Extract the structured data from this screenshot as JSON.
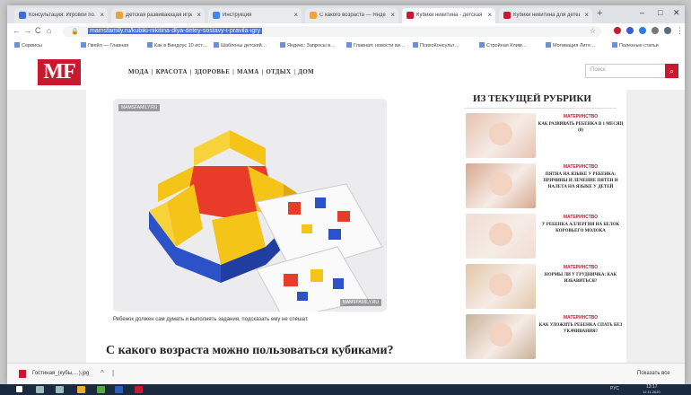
{
  "browser": {
    "tabs": [
      {
        "title": "Консультация: Игровой по…",
        "color": "#3c6fd1",
        "active": false
      },
      {
        "title": "Детская развивающая игра…",
        "color": "#e8a33b",
        "active": false
      },
      {
        "title": "Инструкция",
        "color": "#4285f4",
        "active": false
      },
      {
        "title": "С какого возраста — Яндекс",
        "color": "#f2a33a",
        "active": false
      },
      {
        "title": "Кубики никитина - детская…",
        "color": "#c8192f",
        "active": true
      },
      {
        "title": "Кубики никитина для детей…",
        "color": "#c8192f",
        "active": false
      }
    ],
    "new_tab": "+",
    "address": {
      "url": "mamsfamily.ru/kubiki-nikitina-dlya-detey-sostavy-i-pravila-igry",
      "back": "←",
      "forward": "→",
      "reload": "C",
      "home": "⌂"
    },
    "bookmarks": [
      "Сервисы",
      "Гмейл — Главная",
      "Как в Виндоус 10 ист…",
      "Шаблоны детский…",
      "Яндекс: Запросы в…",
      "Главная: новости ви…",
      "ПсихоКонсульт…",
      "Стройная Клим…",
      "Мотивация Лите…",
      "Полезные статьи"
    ]
  },
  "site": {
    "logo": "MF",
    "nav": [
      "МОДА",
      "КРАСОТА",
      "ЗДОРОВЬЕ",
      "МАМА",
      "ОТДЫХ",
      "ДОМ"
    ],
    "nav_separator": "|",
    "search_placeholder": "Поиск",
    "search_icon": "search-icon"
  },
  "article": {
    "watermark_top": "MAMSFAMILY.RU",
    "watermark_bottom": "MAMSFAMILY.RU",
    "caption": "Ребенок должен сам думать и выполнять задания, подсказать ему не спешат.",
    "heading": "С какого возраста можно пользоваться кубиками?"
  },
  "sidebar": {
    "title": "ИЗ ТЕКУЩЕЙ РУБРИКИ",
    "items": [
      {
        "category": "МАТЕРИНСТВО",
        "title": "КАК РАЗВИВАТЬ РЕБЕНКА В 1 МЕСЯЦ (0)",
        "thumb": "#e7c3b0"
      },
      {
        "category": "МАТЕРИНСТВО",
        "title": "ПЯТНА НА ЯЗЫКЕ У РЕБЕНКА: ПРИЧИНЫ И ЛЕЧЕНИЕ ПЯТЕН И НАЛЕТА НА ЯЗЫКЕ У ДЕТЕЙ",
        "thumb": "#d9a890"
      },
      {
        "category": "МАТЕРИНСТВО",
        "title": "У РЕБЕНКА АЛЛЕРГИЯ НА БЕЛОК КОРОВЬЕГО МОЛОКА",
        "thumb": "#f1ddd3"
      },
      {
        "category": "МАТЕРИНСТВО",
        "title": "НОРМЫ ЛИ У ГРУДНИЧКА: КАК ИЗБАВИТЬСЯ?",
        "thumb": "#e2c7a8"
      },
      {
        "category": "МАТЕРИНСТВО",
        "title": "КАК УЛОЖИТЬ РЕБЕНКА СПАТЬ БЕЗ УКАЧИВАНИЯ?",
        "thumb": "#c9b29a"
      }
    ]
  },
  "downloads": {
    "filename": "Гостиная_(кубы,…).jpg",
    "show_all": "Показать все"
  },
  "taskbar": {
    "clock": "13:17",
    "date": "12.11.2020",
    "lang": "РУС"
  }
}
